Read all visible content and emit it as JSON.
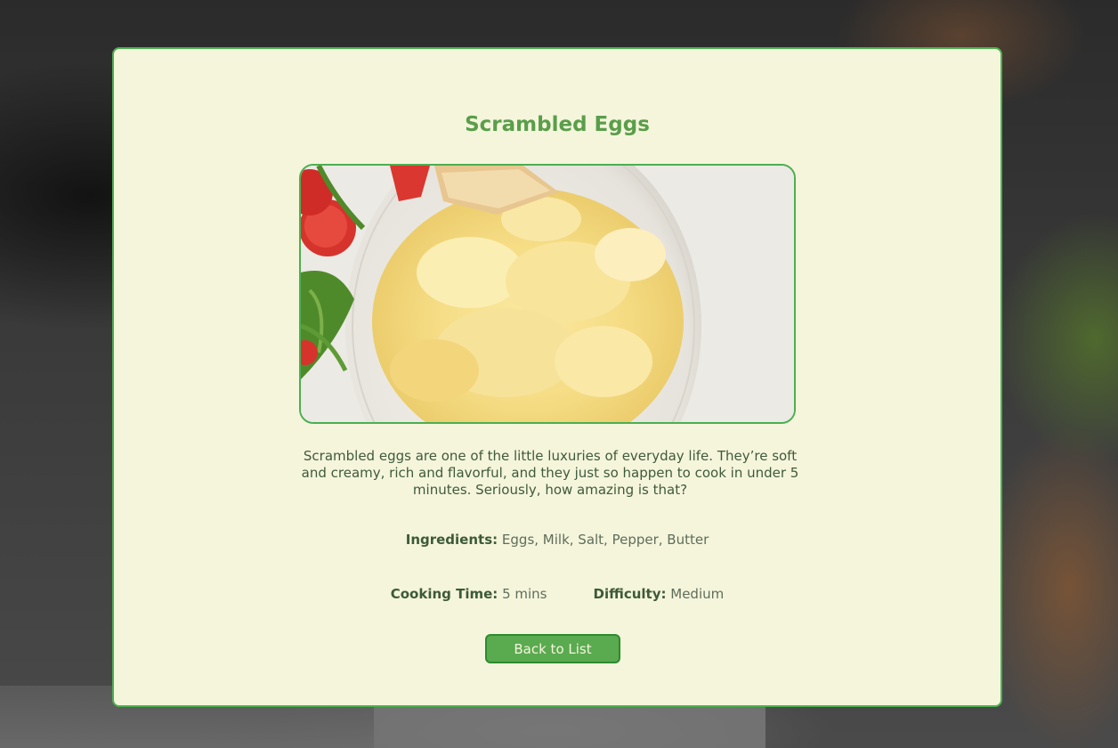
{
  "recipe": {
    "title": "Scrambled Eggs",
    "description": "Scrambled eggs are one of the little luxuries of everyday life. They’re soft and creamy, rich and flavorful, and they just so happen to cook in under 5 minutes. Seriously, how amazing is that?",
    "ingredients_label": "Ingredients:",
    "ingredients_value": "Eggs, Milk, Salt, Pepper, Butter",
    "cooking_time_label": "Cooking Time:",
    "cooking_time_value": "5 mins",
    "difficulty_label": "Difficulty:",
    "difficulty_value": "Medium"
  },
  "actions": {
    "back_label": "Back to List"
  },
  "colors": {
    "card_background": "#f5f5dc",
    "accent_green": "#4caf50",
    "title_green": "#5a9e4b"
  }
}
